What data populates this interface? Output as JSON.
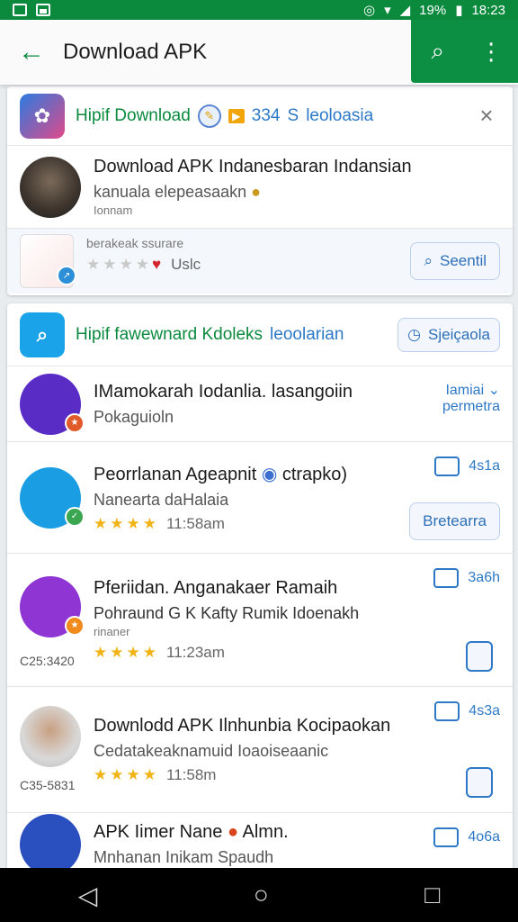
{
  "status": {
    "battery": "19%",
    "time": "18:23"
  },
  "appbar": {
    "title": "Download APK",
    "back": "←",
    "search": "⌕",
    "more": "⋮"
  },
  "card1": {
    "header": {
      "title": "Hipif Download",
      "count": "334",
      "suffix": "S",
      "tag": "leoloasia",
      "close": "×"
    },
    "rows": [
      {
        "title": "Download APK Indanesbaran Indansian",
        "subtitle": "kanuala elepeasaakn",
        "note": "Ionnam"
      },
      {
        "title": "berakeak ssurare",
        "rating_meta": "Uslc",
        "button": "Seentil"
      }
    ]
  },
  "card2": {
    "header": {
      "title": "Hipif fawewnard Kdoleks",
      "tag": "leoolarian",
      "button": "Sjeiçaola"
    },
    "rows": [
      {
        "title": "IMamokarah Iodanlia. lasangoiin",
        "subtitle": "Pokaguioln",
        "side_top": "Iamiai",
        "side_bottom": "permetra"
      },
      {
        "title": "Peorrlanan Ageapnit",
        "title_extra": "ctrapko)",
        "subtitle": "Nanearta daHalaia",
        "rating_meta": "11:58am",
        "side": "4s1a",
        "button": "Bretearra"
      },
      {
        "title": "Pferiidan. Anganakaer Ramaih",
        "subtitle": "Pohraund G K Kafty Rumik Idoenakh",
        "note": "rinaner",
        "left_meta": "C25:3420",
        "rating_meta": "11:23am",
        "side": "3a6h"
      },
      {
        "title": "Downlodd APK Ilnhunbia Kocipaokan",
        "subtitle": "Cedatakeaknamuid Ioaoiseaanic",
        "left_meta": "C35-5831",
        "rating_meta": "11:58m",
        "side": "4s3a"
      },
      {
        "title": "APK Iimer Nane",
        "title_extra": "Almn.",
        "subtitle": "Mnhanan Inikam Spaudh",
        "side": "4o6a"
      }
    ]
  },
  "nav": {
    "back": "◁",
    "home": "○",
    "recents": "□"
  },
  "colors": {
    "brand_green": "#0b8a3e",
    "link_blue": "#2d79c7",
    "star": "#f1b417"
  }
}
